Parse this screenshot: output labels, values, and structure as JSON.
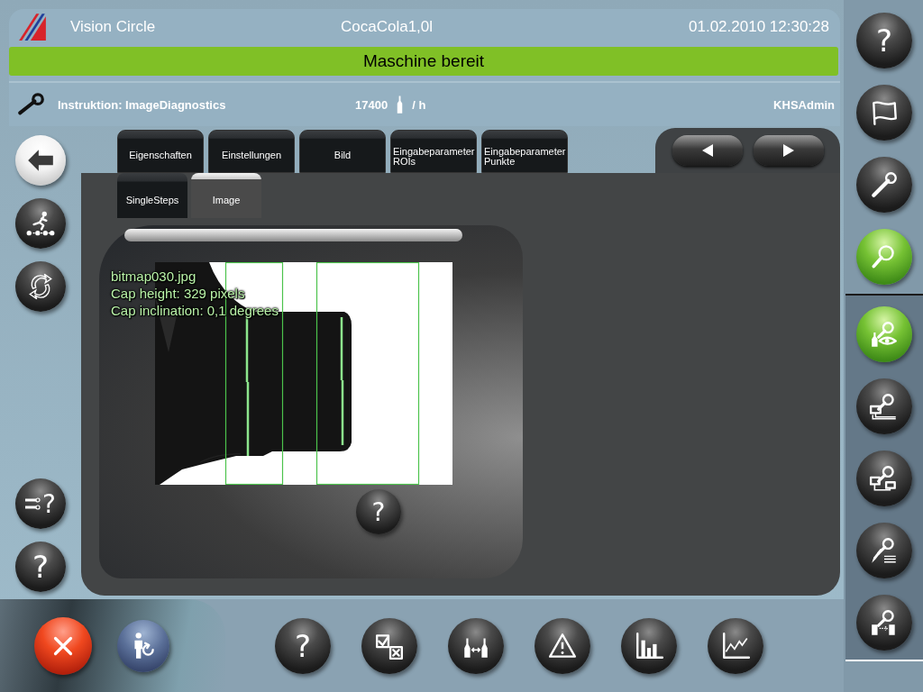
{
  "header": {
    "app_name": "Vision Circle",
    "product": "CocaCola1,0l",
    "datetime": "01.02.2010 12:30:28"
  },
  "status_banner": {
    "text": "Maschine bereit",
    "color": "#80c026"
  },
  "info_bar": {
    "instruction": "Instruktion: ImageDiagnostics",
    "rate_value": "17400",
    "rate_unit": "/ h",
    "user": "KHSAdmin"
  },
  "left_buttons_top": [
    {
      "kind": "back"
    },
    {
      "kind": "steps"
    },
    {
      "kind": "refresh"
    }
  ],
  "left_buttons_bottom": [
    {
      "kind": "routing-help",
      "label": "?"
    },
    {
      "kind": "help",
      "label": "?"
    }
  ],
  "tabs": [
    {
      "label": "Eigenschaften",
      "selected": false
    },
    {
      "label": "Einstellungen",
      "selected": false
    },
    {
      "label": "Bild",
      "selected": false
    },
    {
      "label": "Eingabeparameter ROIs",
      "selected": false
    },
    {
      "label": "Eingabeparameter Punkte",
      "selected": false
    }
  ],
  "sub_tabs": [
    {
      "label": "SingleSteps",
      "selected": false
    },
    {
      "label": "Image",
      "selected": true
    }
  ],
  "viewer": {
    "overlay_lines": [
      "bitmap030.jpg",
      "Cap height: 329 pixels",
      "Cap inclination: 0,1 degrees"
    ],
    "help_label": "?"
  },
  "bottom_left": [
    {
      "kind": "cancel"
    },
    {
      "kind": "user-switch"
    }
  ],
  "toolbar": [
    {
      "kind": "help",
      "label": "?"
    },
    {
      "kind": "checklist"
    },
    {
      "kind": "bottle-transfer"
    },
    {
      "kind": "warning"
    },
    {
      "kind": "bar-chart"
    },
    {
      "kind": "line-chart"
    }
  ],
  "right_nav": [
    {
      "kind": "help",
      "label": "?",
      "selected": false
    },
    {
      "kind": "flag",
      "selected": false
    },
    {
      "kind": "wrench",
      "selected": false
    },
    {
      "kind": "inspect",
      "selected": true
    }
  ],
  "right_subnav": [
    {
      "kind": "inspect-bottle",
      "selected": true
    },
    {
      "kind": "inspect-panel",
      "selected": false
    },
    {
      "kind": "inspect-network",
      "selected": false
    },
    {
      "kind": "inspect-edit",
      "selected": false
    },
    {
      "kind": "inspect-transfer",
      "selected": false
    }
  ]
}
